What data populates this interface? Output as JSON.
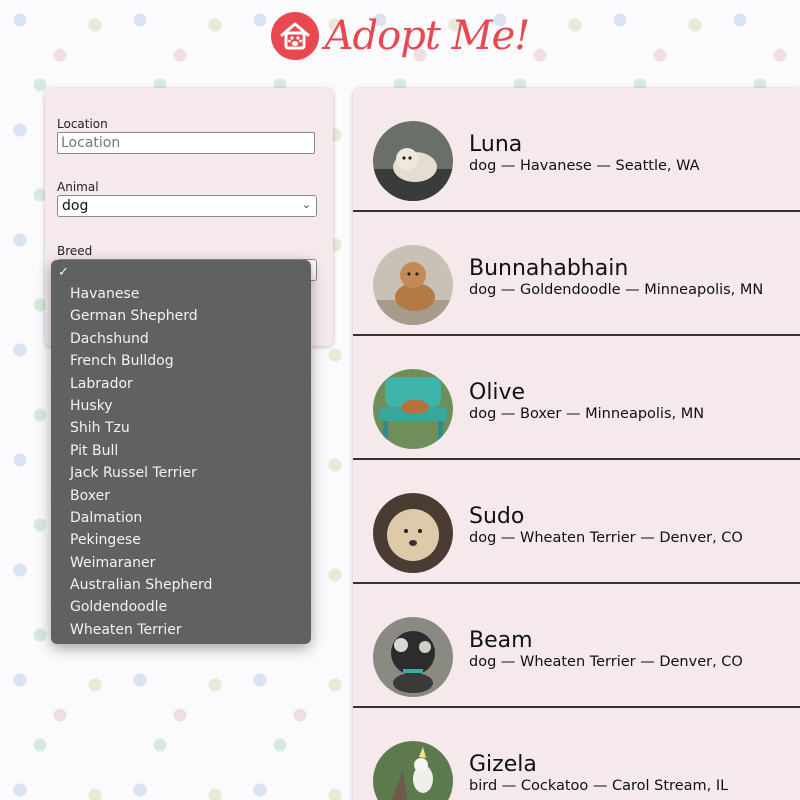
{
  "brand": {
    "title": "Adopt Me!",
    "color": "#e8484f",
    "icon": "house-paw-icon"
  },
  "search": {
    "location_label": "Location",
    "location_placeholder": "Location",
    "animal_label": "Animal",
    "animal_value": "dog",
    "breed_label": "Breed"
  },
  "breed_dropdown": {
    "checkmark": "✓",
    "options": [
      "Havanese",
      "German Shepherd",
      "Dachshund",
      "French Bulldog",
      "Labrador",
      "Husky",
      "Shih Tzu",
      "Pit Bull",
      "Jack Russel Terrier",
      "Boxer",
      "Dalmation",
      "Pekingese",
      "Weimaraner",
      "Australian Shepherd",
      "Goldendoodle",
      "Wheaten Terrier"
    ]
  },
  "pets": [
    {
      "name": "Luna",
      "info": "dog — Havanese — Seattle, WA"
    },
    {
      "name": "Bunnahabhain",
      "info": "dog — Goldendoodle — Minneapolis, MN"
    },
    {
      "name": "Olive",
      "info": "dog — Boxer — Minneapolis, MN"
    },
    {
      "name": "Sudo",
      "info": "dog — Wheaten Terrier — Denver, CO"
    },
    {
      "name": "Beam",
      "info": "dog — Wheaten Terrier — Denver, CO"
    },
    {
      "name": "Gizela",
      "info": "bird — Cockatoo — Carol Stream, IL"
    }
  ]
}
